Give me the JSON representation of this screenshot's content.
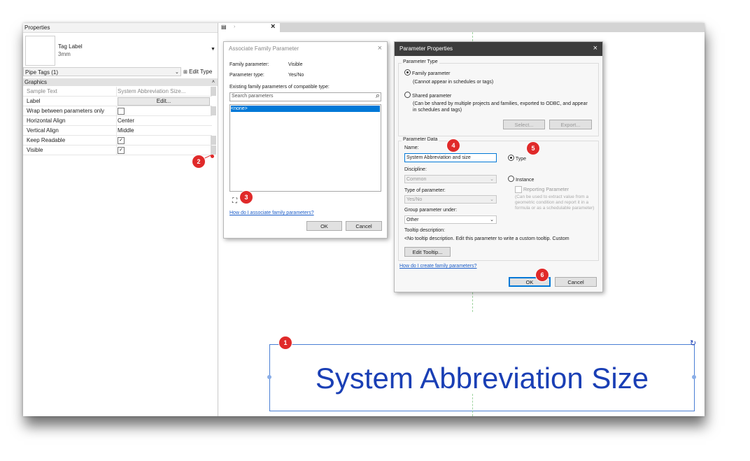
{
  "properties": {
    "title": "Properties",
    "type_name": "Tag Label",
    "type_sub": "3mm",
    "selector": "Pipe Tags (1)",
    "edit_type": "Edit Type",
    "group": "Graphics",
    "rows": [
      {
        "key": "Sample Text",
        "value": "System Abbreviation Size..."
      },
      {
        "key": "Label",
        "value": "Edit..."
      },
      {
        "key": "Wrap between parameters only",
        "value": ""
      },
      {
        "key": "Horizontal Align",
        "value": "Center"
      },
      {
        "key": "Vertical Align",
        "value": "Middle"
      },
      {
        "key": "Keep Readable",
        "value": "✓"
      },
      {
        "key": "Visible",
        "value": "✓"
      }
    ]
  },
  "tabs": {
    "close": "×"
  },
  "assoc_dialog": {
    "title": "Associate Family Parameter",
    "family_param_label": "Family parameter:",
    "family_param_value": "Visible",
    "param_type_label": "Parameter type:",
    "param_type_value": "Yes/No",
    "existing_label": "Existing family parameters of compatible type:",
    "search_placeholder": "Search parameters",
    "list_selected": "<none>",
    "help_link": "How do I associate family parameters?",
    "ok": "OK",
    "cancel": "Cancel"
  },
  "param_dialog": {
    "title": "Parameter Properties",
    "param_type_group": "Parameter Type",
    "family_param": "Family parameter",
    "family_param_note": "(Cannot appear in schedules or tags)",
    "shared_param": "Shared parameter",
    "shared_param_note": "(Can be shared by multiple projects and families, exported to ODBC, and appear in schedules and tags)",
    "select_btn": "Select...",
    "export_btn": "Export...",
    "param_data_group": "Parameter Data",
    "name_label": "Name:",
    "name_value": "System Abbreviation and size",
    "type_radio": "Type",
    "discipline_label": "Discipline:",
    "discipline_value": "Common",
    "instance_radio": "Instance",
    "reporting_param": "Reporting Parameter",
    "reporting_note": "(Can be used to extract value from a geometric condition and report it in a formula or as a schedulable parameter)",
    "type_of_param_label": "Type of parameter:",
    "type_of_param_value": "Yes/No",
    "group_under_label": "Group parameter under:",
    "group_under_value": "Other",
    "tooltip_label": "Tooltip description:",
    "tooltip_text": "<No tooltip description. Edit this parameter to write a custom tooltip. Custom",
    "edit_tooltip": "Edit Tooltip...",
    "help_link": "How do I create family parameters?",
    "ok": "OK",
    "cancel": "Cancel"
  },
  "canvas": {
    "tag_text": "System Abbreviation Size"
  },
  "badges": [
    "1",
    "2",
    "3",
    "4",
    "5",
    "6"
  ],
  "colors": {
    "badge": "#e02a2a",
    "tag_text": "#1a3fb5",
    "link": "#1a5cc8",
    "selection": "#0078d7",
    "dialog_titlebar": "#3c3c3c"
  }
}
